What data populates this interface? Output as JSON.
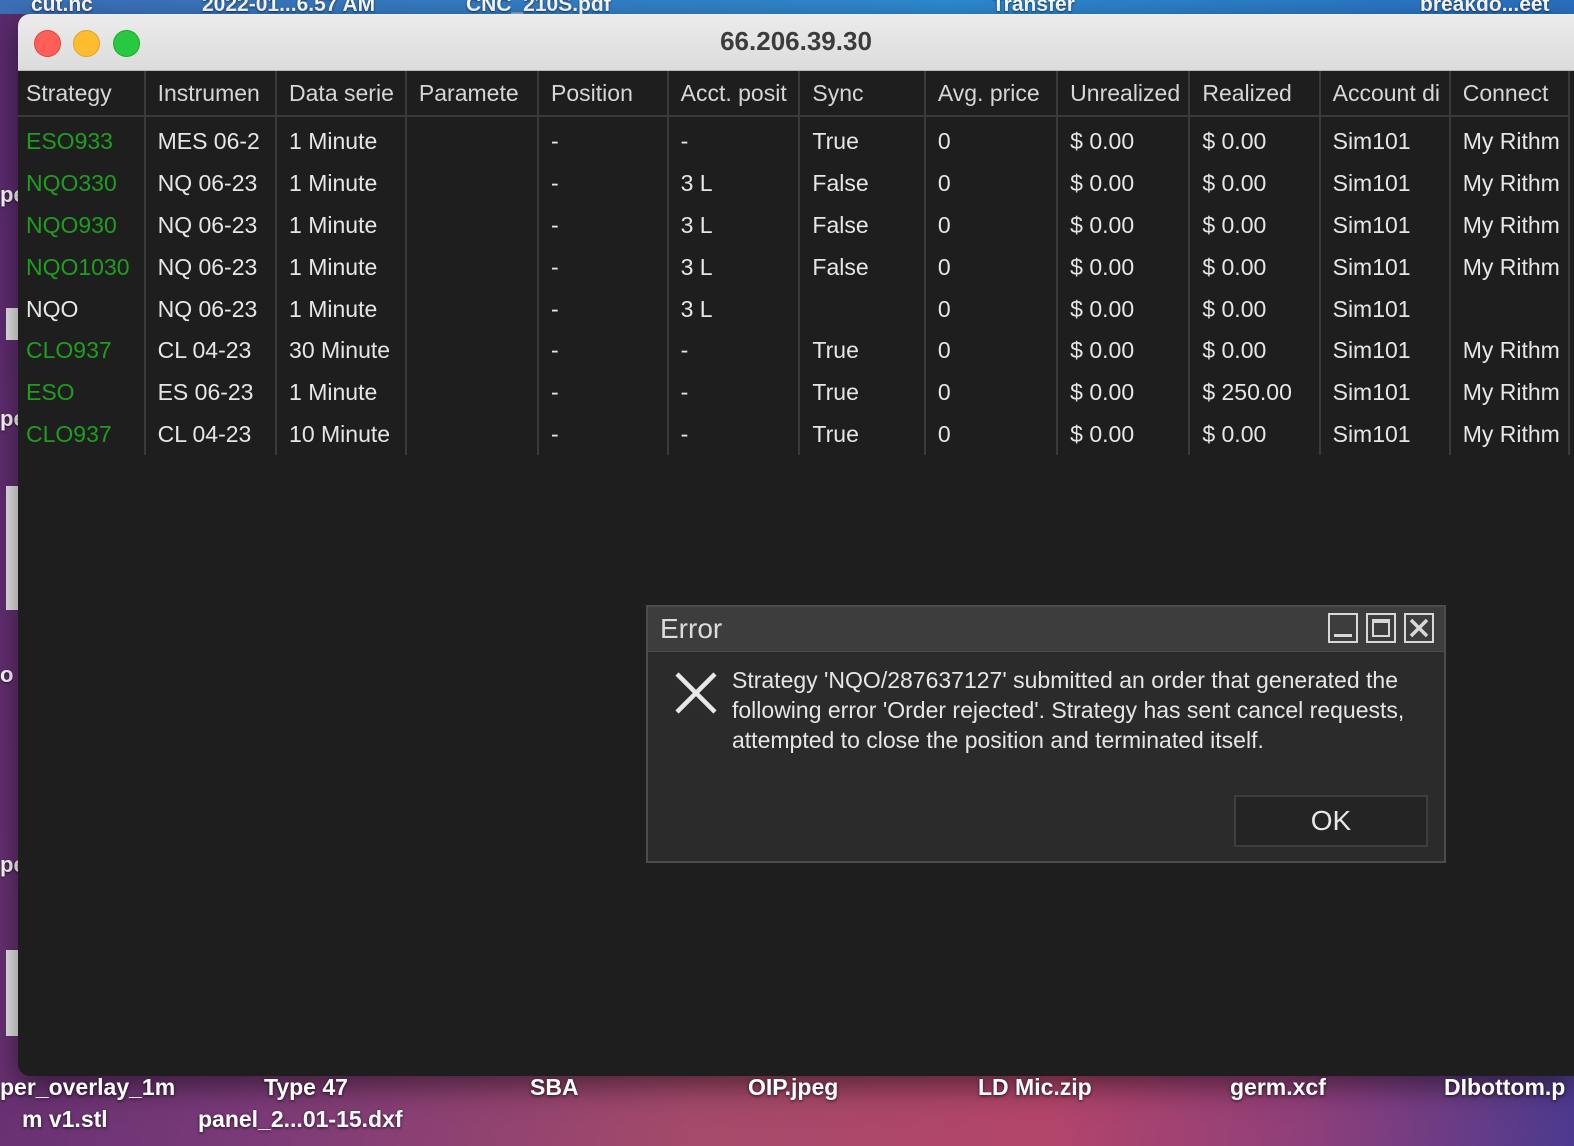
{
  "desktop": {
    "top_files": [
      "cut.nc",
      "2022-01...6.57 AM",
      "CNC_210S.pdf",
      "Transfer",
      "breakdo...eet"
    ],
    "left_fragments": [
      "pe",
      "pe",
      "o",
      "pe"
    ],
    "bottom_files_row1": [
      "per_overlay_1m",
      "Type 47",
      "SBA",
      "OIP.jpeg",
      "LD Mic.zip",
      "germ.xcf",
      "DIbottom.p"
    ],
    "bottom_files_row2": [
      "m v1.stl",
      "panel_2...01-15.dxf"
    ]
  },
  "window": {
    "title": "66.206.39.30"
  },
  "table": {
    "columns": [
      "Strategy",
      "Instrumen",
      "Data serie",
      "Paramete",
      "Position",
      "Acct. posit",
      "Sync",
      "Avg. price",
      "Unrealized",
      "Realized",
      "Account di",
      "Connect"
    ],
    "rows": [
      {
        "strategy": "ESO933",
        "strategy_green": true,
        "instrument": "MES 06-2",
        "data_series": "1 Minute",
        "parameters": "",
        "position": "-",
        "acct_position": "-",
        "sync": "True",
        "avg_price": "0",
        "unrealized": "$ 0.00",
        "realized": "$ 0.00",
        "account": "Sim101",
        "connection": "My Rithm"
      },
      {
        "strategy": "NQO330",
        "strategy_green": true,
        "instrument": "NQ 06-23",
        "data_series": "1 Minute",
        "parameters": "",
        "position": "-",
        "acct_position": "3 L",
        "sync": "False",
        "avg_price": "0",
        "unrealized": "$ 0.00",
        "realized": "$ 0.00",
        "account": "Sim101",
        "connection": "My Rithm"
      },
      {
        "strategy": "NQO930",
        "strategy_green": true,
        "instrument": "NQ 06-23",
        "data_series": "1 Minute",
        "parameters": "",
        "position": "-",
        "acct_position": "3 L",
        "sync": "False",
        "avg_price": "0",
        "unrealized": "$ 0.00",
        "realized": "$ 0.00",
        "account": "Sim101",
        "connection": "My Rithm"
      },
      {
        "strategy": "NQO1030",
        "strategy_green": true,
        "instrument": "NQ 06-23",
        "data_series": "1 Minute",
        "parameters": "",
        "position": "-",
        "acct_position": "3 L",
        "sync": "False",
        "avg_price": "0",
        "unrealized": "$ 0.00",
        "realized": "$ 0.00",
        "account": "Sim101",
        "connection": "My Rithm"
      },
      {
        "strategy": "NQO",
        "strategy_green": false,
        "instrument": "NQ 06-23",
        "data_series": "1 Minute",
        "parameters": "",
        "position": "-",
        "acct_position": "3 L",
        "sync": "",
        "avg_price": "0",
        "unrealized": "$ 0.00",
        "realized": "$ 0.00",
        "account": "Sim101",
        "connection": ""
      },
      {
        "strategy": "CLO937",
        "strategy_green": true,
        "instrument": "CL 04-23",
        "data_series": "30 Minute",
        "parameters": "",
        "position": "-",
        "acct_position": "-",
        "sync": "True",
        "avg_price": "0",
        "unrealized": "$ 0.00",
        "realized": "$ 0.00",
        "account": "Sim101",
        "connection": "My Rithm"
      },
      {
        "strategy": "ESO",
        "strategy_green": true,
        "instrument": "ES 06-23",
        "data_series": "1 Minute",
        "parameters": "",
        "position": "-",
        "acct_position": "-",
        "sync": "True",
        "avg_price": "0",
        "unrealized": "$ 0.00",
        "realized": "$ 250.00",
        "account": "Sim101",
        "connection": "My Rithm"
      },
      {
        "strategy": "CLO937",
        "strategy_green": true,
        "instrument": "CL 04-23",
        "data_series": "10 Minute",
        "parameters": "",
        "position": "-",
        "acct_position": "-",
        "sync": "True",
        "avg_price": "0",
        "unrealized": "$ 0.00",
        "realized": "$ 0.00",
        "account": "Sim101",
        "connection": "My Rithm"
      }
    ]
  },
  "dialog": {
    "title": "Error",
    "message": "Strategy 'NQO/287637127' submitted an order that generated the following error 'Order rejected'. Strategy has sent cancel requests, attempted to close the position and terminated itself.",
    "ok_label": "OK"
  },
  "colors": {
    "strategy_green": "#1e9e1e",
    "window_bg": "#1e1e1e",
    "dialog_bg": "#2b2b2b"
  }
}
